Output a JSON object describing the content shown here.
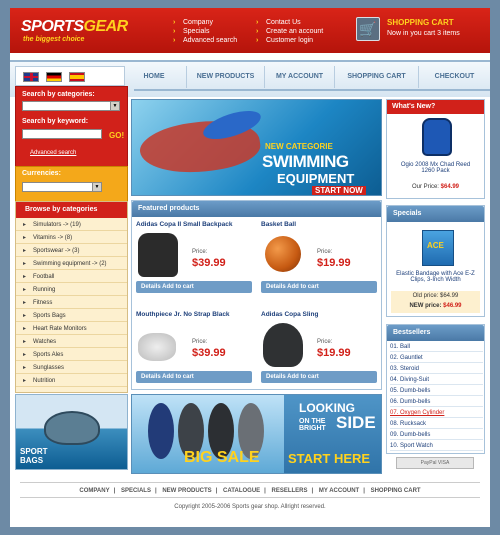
{
  "brand": {
    "name_a": "SPORTS",
    "name_b": "GEAR",
    "tagline": "the biggest choice"
  },
  "top_links": {
    "col1": [
      "Company",
      "Specials",
      "Advanced search"
    ],
    "col2": [
      "Contact Us",
      "Create an account",
      "Customer login"
    ]
  },
  "cart": {
    "title": "SHOPPING CART",
    "subtitle": "Now in you cart 3 items",
    "icon": "cart-icon"
  },
  "languages": [
    "English",
    "Deutsch",
    "Español"
  ],
  "nav": [
    "HOME",
    "NEW PRODUCTS",
    "MY ACCOUNT",
    "SHOPPING CART",
    "CHECKOUT"
  ],
  "search": {
    "by_category": "Search by categories:",
    "by_keyword": "Search by keyword:",
    "go": "GO!",
    "advanced": "Advanced search"
  },
  "currencies": {
    "label": "Currencies:"
  },
  "browse": {
    "title": "Browse by categories",
    "items": [
      "Simulators -> (19)",
      "Vitamins -> (8)",
      "Sportswear -> (3)",
      "Swimming equipment -> (2)",
      "Football",
      "Running",
      "Fitness",
      "Sports Bags",
      "Heart Rate Monitors",
      "Watches",
      "Sports Ales",
      "Sunglasses",
      "Nutrition"
    ]
  },
  "promo_bags": {
    "line1": "SPORT",
    "line2": "BAGS"
  },
  "swim_banner": {
    "line1": "NEW CATEGORIE",
    "line2": "SWIMMING",
    "line3": "EQUIPMENT",
    "cta": "START NOW"
  },
  "featured": {
    "title": "Featured products",
    "price_label": "Price:",
    "button": "Details Add to cart",
    "products": [
      {
        "name": "Adidas Copa II Small Backpack",
        "price": "$39.99"
      },
      {
        "name": "Basket Ball",
        "price": "$19.99"
      },
      {
        "name": "Mouthpiece Jr. No Strap Black",
        "price": "$39.99"
      },
      {
        "name": "Adidas Copa Sling",
        "price": "$19.99"
      }
    ]
  },
  "whats_new": {
    "title": "What's New?",
    "name": "Ogio 2008 Mx Chad Reed 1260 Pack",
    "price_label": "Our Price:",
    "price": "$64.99"
  },
  "specials": {
    "title": "Specials",
    "name": "Elastic Bandage with Ace E-Z Clips, 3-Inch Width",
    "old": "Old price: $64.99",
    "new_label": "NEW price:",
    "new_price": "$46.99"
  },
  "bestsellers": {
    "title": "Bestsellers",
    "items": [
      "01. Ball",
      "02. Gauntlet",
      "03. Steroid",
      "04. Diving-Suit",
      "05. Dumb-bells",
      "06. Dumb-bells",
      "07. Oxygen Cylinder",
      "08. Rucksack",
      "09. Dumb-bells",
      "10. Sport Watch"
    ]
  },
  "payment": "PayPal VISA",
  "sale_banner": {
    "line1": "LOOKING",
    "line2a": "ON THE",
    "line2b": "BRIGHT",
    "line2c": "SIDE",
    "sale": "BIG SALE",
    "cta": "START HERE"
  },
  "footer": {
    "links": [
      "COMPANY",
      "SPECIALS",
      "NEW PRODUCTS",
      "CATALOGUE",
      "RESELLERS",
      "MY ACCOUNT",
      "SHOPPING CART"
    ],
    "copyright": "Copyright 2005-2006 Sports gear shop. Allright reserved."
  },
  "colors": {
    "accent": "#d1211a",
    "yellow": "#ffd21e",
    "blue": "#4a79a6"
  }
}
